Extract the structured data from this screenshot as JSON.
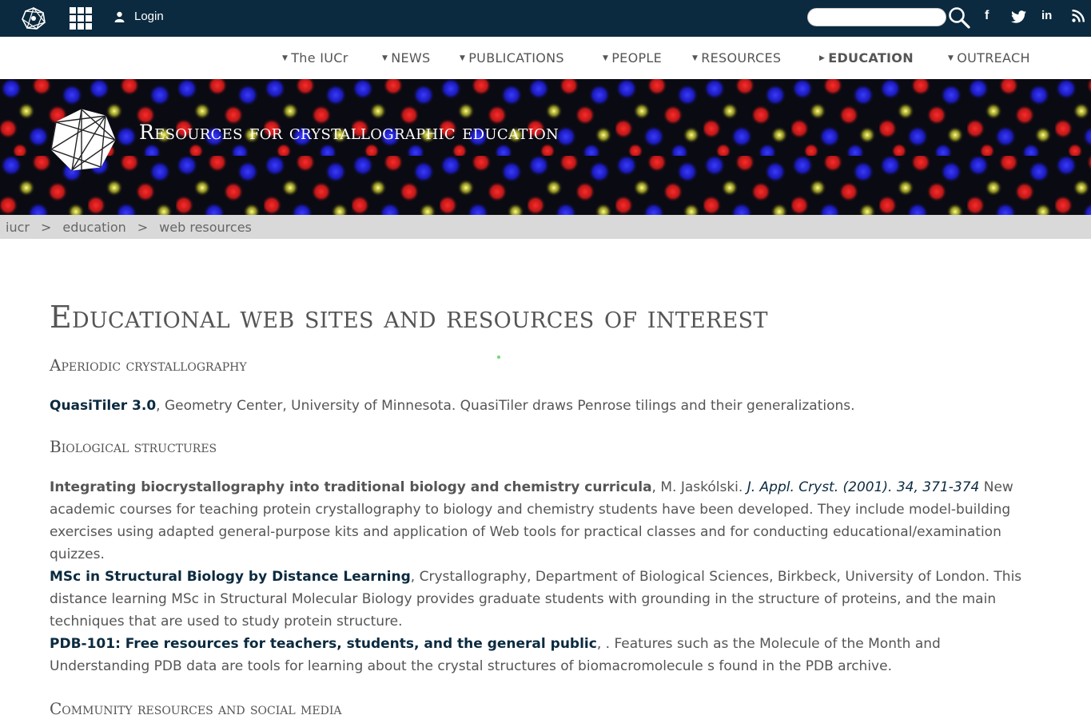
{
  "topbar": {
    "login_label": "Login",
    "search_placeholder": "",
    "social": {
      "facebook": "f",
      "linkedin": "in"
    }
  },
  "nav": {
    "items": [
      {
        "label": "The IUCr"
      },
      {
        "label": "NEWS"
      },
      {
        "label": "PUBLICATIONS"
      },
      {
        "label": "PEOPLE"
      },
      {
        "label": "RESOURCES"
      },
      {
        "label": "EDUCATION",
        "active": true
      },
      {
        "label": "OUTREACH"
      }
    ]
  },
  "banner": {
    "title": "Resources for crystallographic education"
  },
  "breadcrumb": {
    "items": [
      "iucr",
      "education",
      "web resources"
    ],
    "separator": ">"
  },
  "main": {
    "title": "Educational web sites and resources of interest",
    "sections": [
      {
        "heading": "Aperiodic crystallography",
        "entries": [
          {
            "link": "QuasiTiler 3.0",
            "text": ", Geometry Center, University of Minnesota. QuasiTiler draws Penrose tilings and their generalizations."
          }
        ]
      },
      {
        "heading": "Biological structures",
        "entries": [
          {
            "title": "Integrating biocrystallography into traditional biology and chemistry curricula",
            "author": ", M. Jaskólski. ",
            "citation": "J. Appl. Cryst. (2001). 34, 371-374",
            "text": " New academic courses for teaching protein crystallography to biology and chemistry students have been developed. They include model-building exercises using adapted general-purpose kits and application of Web tools for practical classes and for conducting educational/examination quizzes."
          },
          {
            "link": "MSc in Structural Biology by Distance Learning",
            "text": ", Crystallography, Department of Biological Sciences, Birkbeck, University of London. This distance learning MSc in Structural Molecular Biology provides graduate students with grounding in the structure of proteins, and the main techniques that are used to study protein structure."
          },
          {
            "link": "PDB-101: Free resources for teachers, students, and the general public",
            "text": ", . Features such as the Molecule of the Month and Understanding PDB data are tools for learning about the crystal structures of biomacromolecule s found in the PDB archive."
          }
        ]
      },
      {
        "heading": "Community resources and social media",
        "entries": []
      }
    ]
  },
  "colors": {
    "topbar": "#0b2a3f",
    "link": "#0b2a3f",
    "text": "#555555",
    "breadcrumb_bg": "#d9d9d9"
  }
}
